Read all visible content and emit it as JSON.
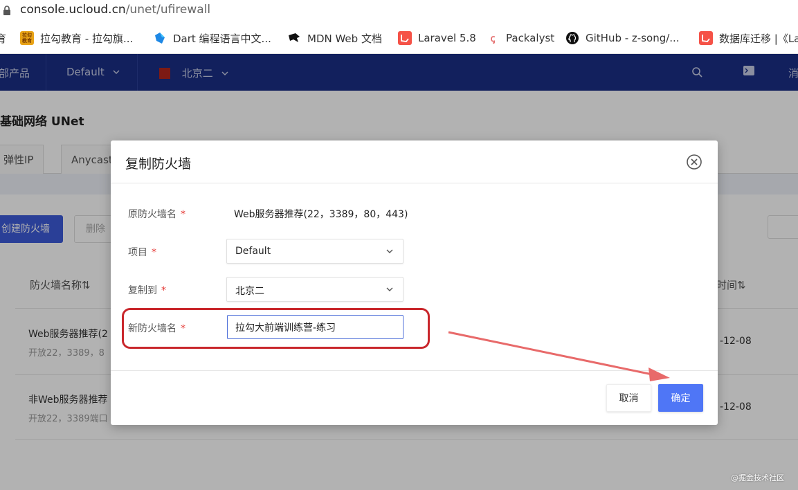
{
  "browser": {
    "url_host": "console.ucloud.cn",
    "url_path": "/unet/ufirewall",
    "bookmarks": [
      {
        "label": "育",
        "icon": "cut-off-bookmark-icon"
      },
      {
        "label": "拉勾教育 - 拉勾旗...",
        "icon": "lagou-icon",
        "color": "#e8a317",
        "icon_text": "拉勾\n教育"
      },
      {
        "label": "Dart 编程语言中文...",
        "icon": "dart-icon",
        "color": "#1e88e5"
      },
      {
        "label": "MDN Web 文档",
        "icon": "mdn-icon",
        "color": "#111111"
      },
      {
        "label": "Laravel 5.8",
        "icon": "laravel-icon",
        "color": "#f55247"
      },
      {
        "label": "Packalyst",
        "icon": "packalyst-icon",
        "color": "#e57373"
      },
      {
        "label": "GitHub - z-song/...",
        "icon": "github-icon",
        "color": "#111111"
      },
      {
        "label": "数据库迁移 |《La",
        "icon": "laravel-china-icon",
        "color": "#f55247"
      }
    ]
  },
  "topnav": {
    "products": "部产品",
    "project": "Default",
    "region": "北京二",
    "right_label": "消"
  },
  "page": {
    "title": "基础网络 UNet",
    "tabs": [
      "弹性IP",
      "Anycast"
    ],
    "create_button": "创建防火墙",
    "delete_button": "删除",
    "columns": {
      "name": "防火墙名称⇅",
      "time": "时间⇅"
    },
    "rows": [
      {
        "name": "Web服务器推荐(2",
        "desc": "开放22，3389，8",
        "time": "-12-08"
      },
      {
        "name": "非Web服务器推荐",
        "desc": "开放22，3389端口",
        "time": "-12-08"
      }
    ]
  },
  "dialog": {
    "title": "复制防火墙",
    "fields": {
      "original_name_label": "原防火墙名",
      "original_name_value": "Web服务器推荐(22，3389，80，443)",
      "project_label": "项目",
      "project_value": "Default",
      "copy_to_label": "复制到",
      "copy_to_value": "北京二",
      "new_name_label": "新防火墙名",
      "new_name_value": "拉勾大前端训练营-练习"
    },
    "required_mark": "*",
    "cancel_label": "取消",
    "confirm_label": "确定"
  },
  "annotation": {
    "highlight_color": "#c9272c",
    "arrow_color": "#e86a6a"
  },
  "watermark": "@掘金技术社区",
  "colors": {
    "nav_bg": "#1b2e86",
    "primary": "#4f76f6",
    "required": "#e53935"
  }
}
